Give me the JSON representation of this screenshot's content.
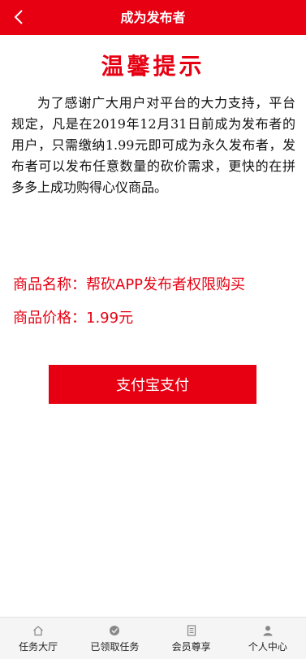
{
  "header": {
    "title": "成为发布者",
    "back_icon": "chevron-left-icon",
    "background": "#e60012"
  },
  "notice": {
    "title": "温馨提示",
    "body": "为了感谢广大用户对平台的大力支持，平台规定，凡是在2019年12月31日前成为发布者的用户，只需缴纳1.99元即可成为永久发布者，发布者可以发布任意数量的砍价需求，更快的在拼多多上成功购得心仪商品。"
  },
  "product": {
    "name_label": "商品名称：帮砍APP发布者权限购买",
    "price_label": "商品价格：1.99元"
  },
  "pay_button": {
    "label": "支付宝支付"
  },
  "tabbar": {
    "items": [
      {
        "label": "任务大厅",
        "icon": "home-icon"
      },
      {
        "label": "已领取任务",
        "icon": "task-icon"
      },
      {
        "label": "会员尊享",
        "icon": "member-icon"
      },
      {
        "label": "个人中心",
        "icon": "user-icon"
      }
    ]
  },
  "colors": {
    "accent": "#e60012",
    "tabbar_bg": "#f5f5f5"
  }
}
